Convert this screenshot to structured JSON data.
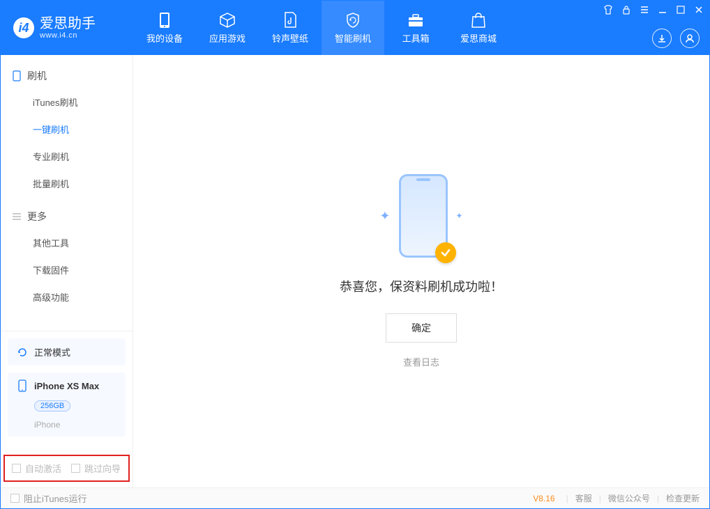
{
  "logo": {
    "title": "爱思助手",
    "url": "www.i4.cn"
  },
  "nav": {
    "tabs": [
      {
        "label": "我的设备"
      },
      {
        "label": "应用游戏"
      },
      {
        "label": "铃声壁纸"
      },
      {
        "label": "智能刷机"
      },
      {
        "label": "工具箱"
      },
      {
        "label": "爱思商城"
      }
    ]
  },
  "sidebar": {
    "group1_label": "刷机",
    "items1": [
      {
        "label": "iTunes刷机"
      },
      {
        "label": "一键刷机"
      },
      {
        "label": "专业刷机"
      },
      {
        "label": "批量刷机"
      }
    ],
    "group2_label": "更多",
    "items2": [
      {
        "label": "其他工具"
      },
      {
        "label": "下载固件"
      },
      {
        "label": "高级功能"
      }
    ],
    "mode_label": "正常模式",
    "device": {
      "name": "iPhone XS Max",
      "capacity": "256GB",
      "type": "iPhone"
    },
    "chk_auto_activate": "自动激活",
    "chk_skip_guide": "跳过向导"
  },
  "main": {
    "success_text": "恭喜您，保资料刷机成功啦！",
    "ok_label": "确定",
    "log_label": "查看日志"
  },
  "footer": {
    "block_itunes": "阻止iTunes运行",
    "version": "V8.16",
    "links": [
      "客服",
      "微信公众号",
      "检查更新"
    ]
  }
}
